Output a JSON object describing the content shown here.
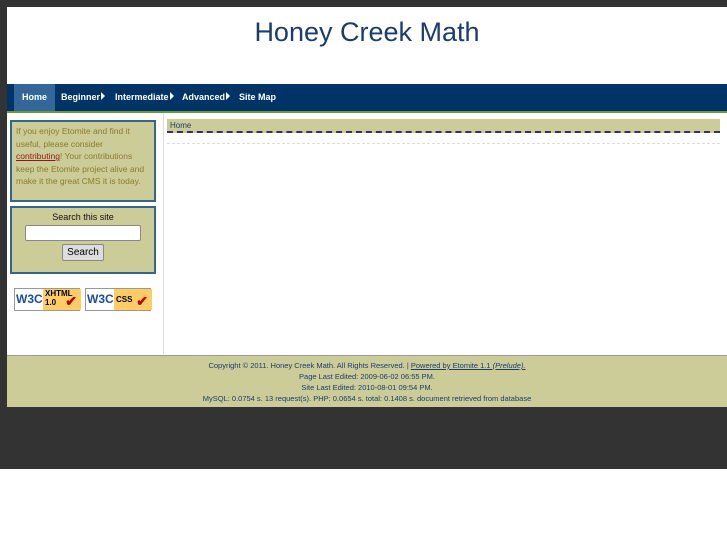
{
  "site_title": "Honey Creek Math",
  "nav": [
    {
      "label": "Home"
    },
    {
      "label": "Beginner",
      "submenu": true
    },
    {
      "label": "Intermediate",
      "submenu": true
    },
    {
      "label": "Advanced",
      "submenu": true
    },
    {
      "label": "Site Map"
    }
  ],
  "donate": {
    "pre": "If you enjoy Etomite and find it useful, please consider ",
    "link": "contributing",
    "post": "! Your contributions keep the Etomite project alive and make it the great CMS it is today."
  },
  "search": {
    "title": "Search this site",
    "value": "",
    "button": "Search"
  },
  "badges": [
    {
      "w3c": "W3C",
      "label": "XHTML 1.0"
    },
    {
      "w3c": "W3C",
      "label": "CSS"
    }
  ],
  "breadcrumb": "Home",
  "footer": {
    "copyright": "Copyright © 2011. Honey Creek Math. All Rights Reserved. | ",
    "powered": "Powered by Etomite 1.1",
    "powered_theme": "(Prelude).",
    "page_edited": "Page Last Edited: 2009-06-02 06:55 PM.",
    "site_edited": "Site Last Edited: 2010-08-01 09:54 PM.",
    "stats": "MySQL: 0.0754 s. 13 request(s). PHP: 0.0654 s. total: 0.1408 s. document retrieved from database"
  }
}
